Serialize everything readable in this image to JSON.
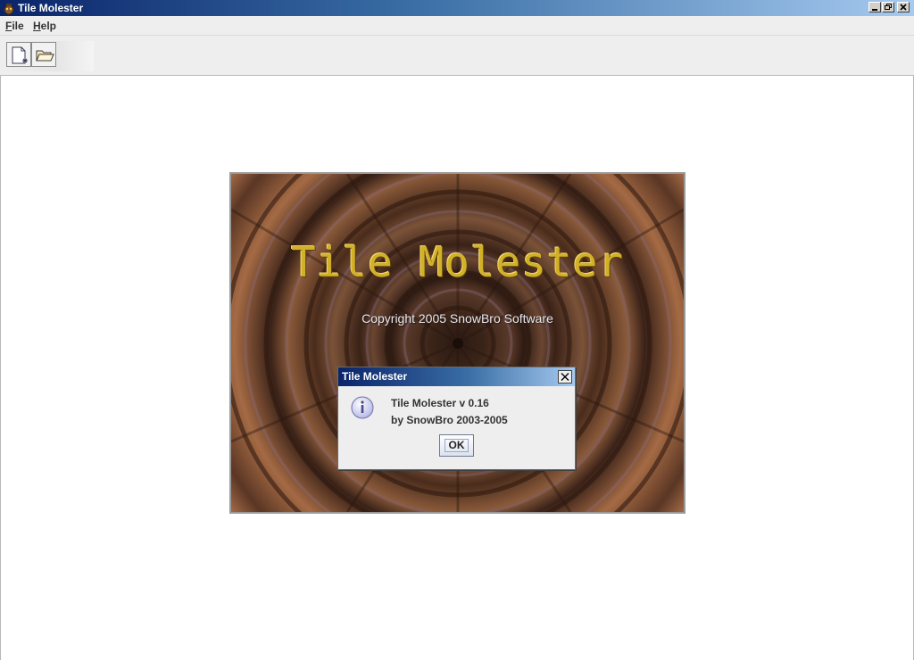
{
  "window": {
    "title": "Tile Molester",
    "controls": [
      "minimize-icon",
      "restore-icon",
      "close-icon"
    ]
  },
  "menu": {
    "file": {
      "mnemonic": "F",
      "rest": "ile"
    },
    "help": {
      "mnemonic": "H",
      "rest": "elp"
    }
  },
  "toolbar": {
    "icons": [
      "new-file-icon",
      "open-folder-icon"
    ]
  },
  "splash": {
    "title": "Tile Molester",
    "copyright": "Copyright 2005 SnowBro Software"
  },
  "dialog": {
    "title": "Tile Molester",
    "message_line1": "Tile Molester v 0.16",
    "message_line2": "by SnowBro 2003-2005",
    "ok_label": "OK",
    "icon": "info-icon"
  },
  "colors": {
    "titlebar_start": "#0a246a",
    "titlebar_end": "#a6caf0",
    "splash_title": "#d2b028",
    "window_bg": "#eeeeee"
  }
}
